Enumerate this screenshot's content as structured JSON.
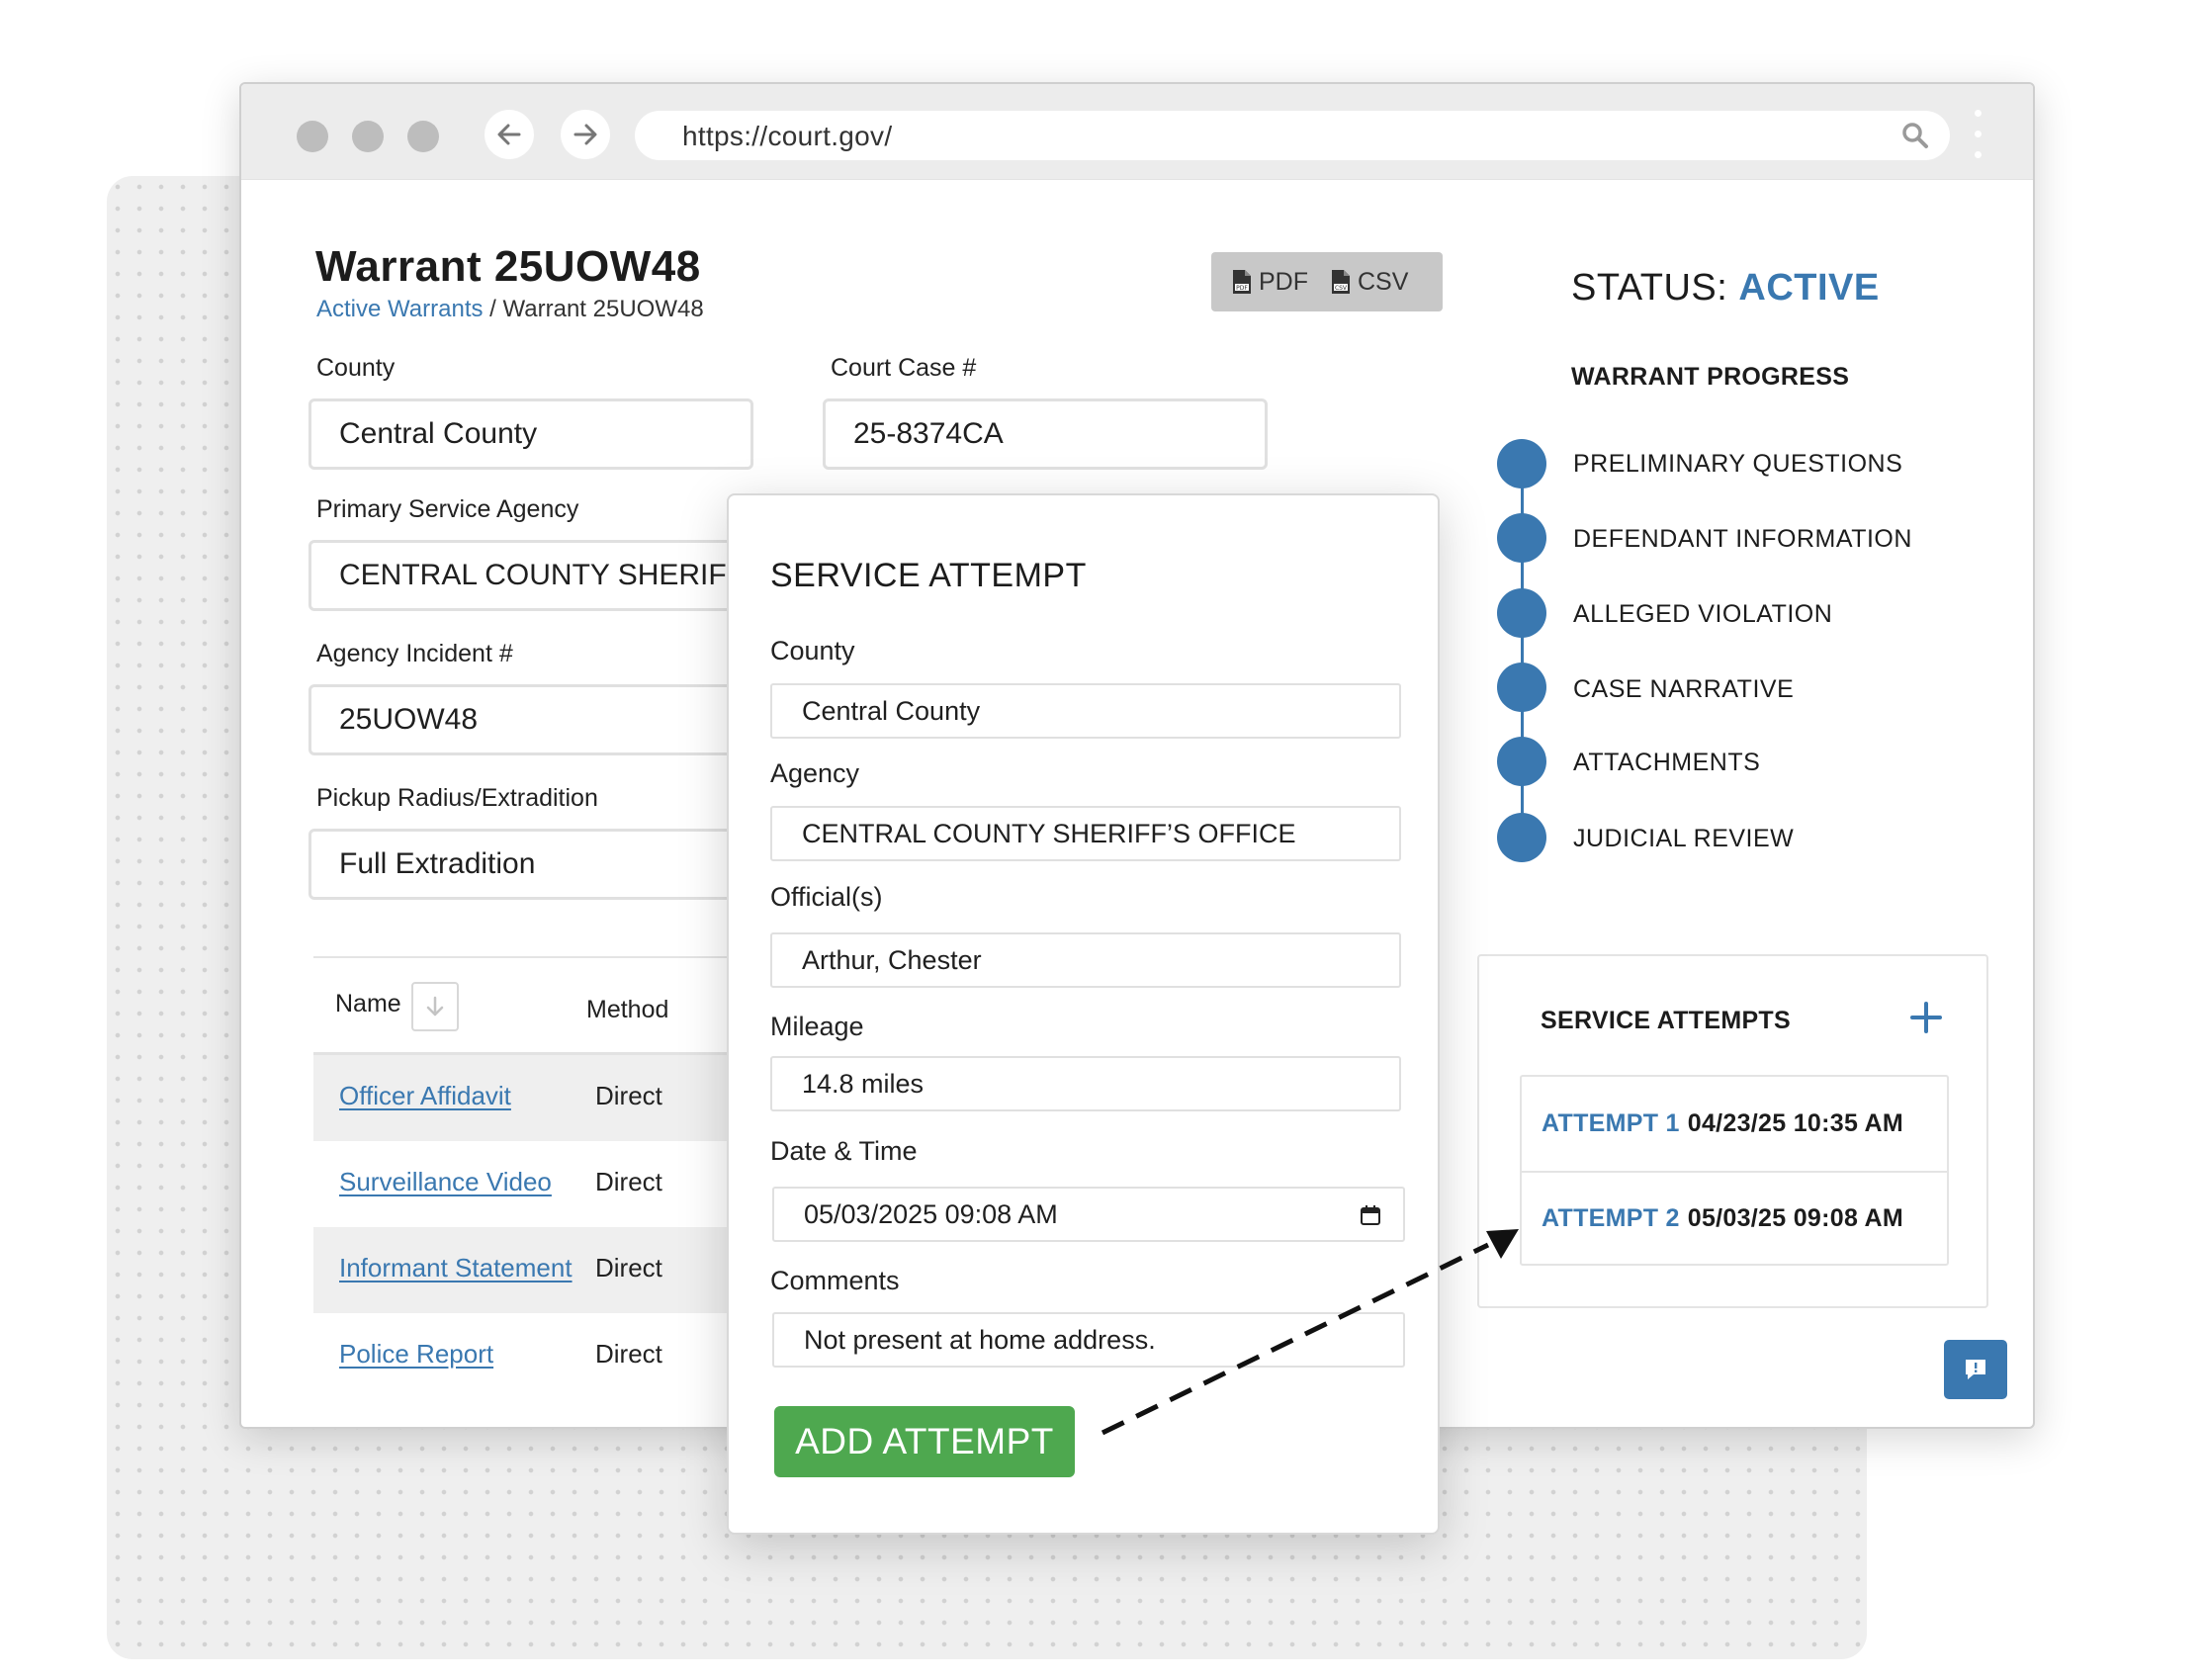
{
  "browser": {
    "url": "https://court.gov/"
  },
  "page": {
    "title": "Warrant 25UOW48",
    "breadcrumb_link": "Active Warrants",
    "breadcrumb_separator": " / ",
    "breadcrumb_current": "Warrant 25UOW48"
  },
  "export": {
    "pdf_label": "PDF",
    "csv_label": "CSV"
  },
  "form": {
    "county_label": "County",
    "county_value": "Central County",
    "court_case_label": "Court Case #",
    "court_case_value": "25-8374CA",
    "agency_label": "Primary Service Agency",
    "agency_value": "CENTRAL COUNTY SHERIFF",
    "incident_label": "Agency Incident #",
    "incident_value": "25UOW48",
    "radius_label": "Pickup Radius/Extradition",
    "radius_value": "Full Extradition"
  },
  "documents": {
    "col_name": "Name",
    "col_method": "Method",
    "rows": [
      {
        "name": "Officer Affidavit",
        "method": "Direct"
      },
      {
        "name": "Surveillance Video",
        "method": "Direct"
      },
      {
        "name": "Informant Statement",
        "method": "Direct"
      },
      {
        "name": "Police Report",
        "method": "Direct"
      }
    ]
  },
  "status": {
    "label": "STATUS: ",
    "value": "ACTIVE"
  },
  "progress": {
    "title": "WARRANT PROGRESS",
    "steps": [
      "PRELIMINARY QUESTIONS",
      "DEFENDANT INFORMATION",
      "ALLEGED VIOLATION",
      "CASE NARRATIVE",
      "ATTACHMENTS",
      "JUDICIAL REVIEW"
    ]
  },
  "service_attempts": {
    "title": "SERVICE ATTEMPTS",
    "items": [
      {
        "label": "ATTEMPT 1",
        "datetime": "04/23/25 10:35 AM"
      },
      {
        "label": "ATTEMPT 2",
        "datetime": "05/03/25 09:08 AM"
      }
    ]
  },
  "modal": {
    "title": "SERVICE ATTEMPT",
    "county_label": "County",
    "county_value": "Central County",
    "agency_label": "Agency",
    "agency_value": "CENTRAL COUNTY SHERIFF’S OFFICE",
    "officials_label": "Official(s)",
    "officials_value": "Arthur, Chester",
    "mileage_label": "Mileage",
    "mileage_value": "14.8 miles",
    "datetime_label": "Date & Time",
    "datetime_value": "05/03/2025 09:08 AM",
    "comments_label": "Comments",
    "comments_value": "Not present at home address.",
    "submit_label": "ADD ATTEMPT"
  },
  "colors": {
    "accent_blue": "#3a78b0",
    "submit_green": "#4ea84f"
  },
  "icons": [
    "back-arrow-icon",
    "forward-arrow-icon",
    "search-icon",
    "kebab-menu-icon",
    "pdf-file-icon",
    "csv-file-icon",
    "sort-down-icon",
    "plus-icon",
    "calendar-icon",
    "feedback-icon"
  ]
}
